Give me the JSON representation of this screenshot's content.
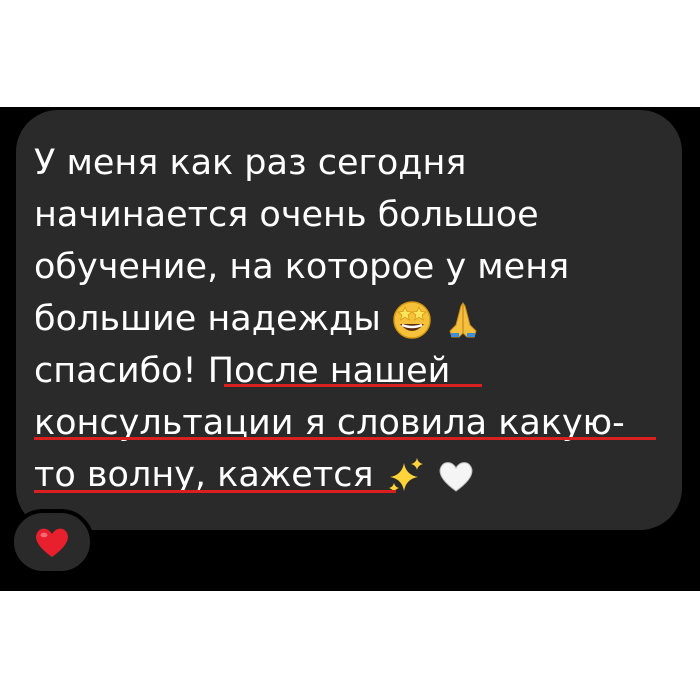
{
  "message": {
    "lines": [
      "У меня как раз сегодня",
      "начинается очень большое",
      "обучение, на которое у меня",
      "большие надежды",
      "спасибо! После нашей",
      "консультации я словила какую-",
      "то волну, кажется"
    ],
    "line4_emojis": [
      "star-struck-emoji",
      "folded-hands-emoji"
    ],
    "line7_emojis": [
      "sparkles-emoji",
      "white-heart-emoji"
    ]
  },
  "reaction": {
    "icon": "red-heart-icon"
  },
  "colors": {
    "bubble": "#2a2a2a",
    "background": "#000000",
    "text": "#ffffff",
    "underline": "#d91f1f",
    "heart": "#e8202e"
  }
}
